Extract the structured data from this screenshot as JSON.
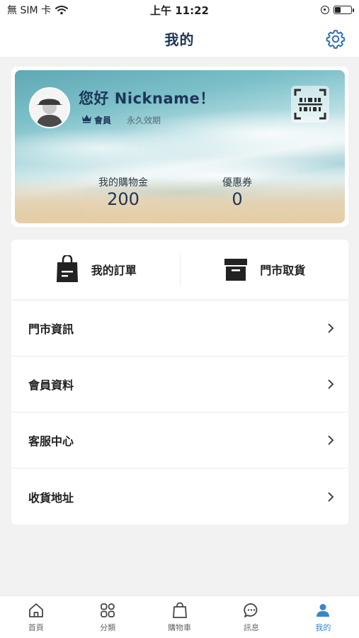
{
  "status_bar": {
    "carrier": "無 SIM 卡",
    "time": "上午 11:22",
    "battery_level": 0.35
  },
  "header": {
    "title": "我的",
    "settings_icon": "gear-icon"
  },
  "member_card": {
    "greeting": "您好 Nickname！",
    "tier": "會員",
    "validity": "永久效期",
    "qr_icon": "barcode-scan-icon",
    "stats": [
      {
        "label": "我的購物金",
        "value": "200"
      },
      {
        "label": "優惠券",
        "value": "0"
      }
    ]
  },
  "quick_actions": [
    {
      "label": "我的訂單",
      "icon": "shopping-bag-icon"
    },
    {
      "label": "門市取貨",
      "icon": "archive-box-icon"
    }
  ],
  "menu": [
    {
      "label": "門市資訊"
    },
    {
      "label": "會員資料"
    },
    {
      "label": "客服中心"
    },
    {
      "label": "收貨地址"
    }
  ],
  "tab_bar": {
    "active_color": "#3a86c8",
    "items": [
      {
        "label": "首頁",
        "icon": "home-icon"
      },
      {
        "label": "分類",
        "icon": "category-grid-icon"
      },
      {
        "label": "購物車",
        "icon": "shopping-bag-icon"
      },
      {
        "label": "訊息",
        "icon": "chat-bubble-icon"
      },
      {
        "label": "我的",
        "icon": "user-icon",
        "active": true
      }
    ]
  }
}
